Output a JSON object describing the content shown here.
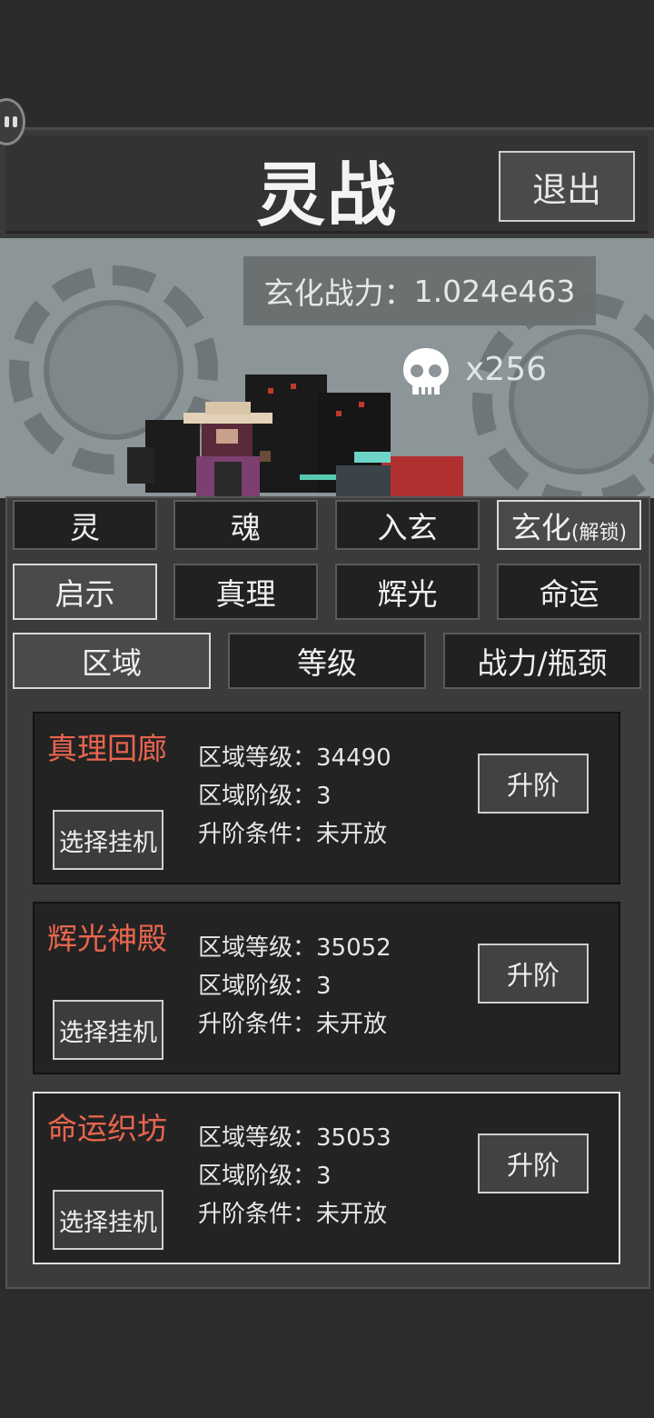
{
  "header": {
    "title": "灵战",
    "exit_label": "退出"
  },
  "battle": {
    "power_label": "玄化战力：",
    "power_value": "1.024e463",
    "kills": "x256",
    "kill_icon": "skull-icon"
  },
  "tabs_row1": [
    {
      "label": "灵"
    },
    {
      "label": "魂"
    },
    {
      "label": "入玄"
    },
    {
      "label": "玄化",
      "sub": "(解锁)"
    }
  ],
  "tabs_row2": [
    {
      "label": "启示",
      "active": true
    },
    {
      "label": "真理"
    },
    {
      "label": "辉光"
    },
    {
      "label": "命运"
    }
  ],
  "tabs_row3": [
    {
      "label": "区域",
      "active": true
    },
    {
      "label": "等级"
    },
    {
      "label": "战力/瓶颈"
    }
  ],
  "zones": [
    {
      "name": "真理回廊",
      "level_label": "区域等级：",
      "level": "34490",
      "stage_label": "区域阶级：",
      "stage": "3",
      "cond_label": "升阶条件：",
      "cond": "未开放",
      "select_label": "选择挂机",
      "upgrade_label": "升阶",
      "selected": false
    },
    {
      "name": "辉光神殿",
      "level_label": "区域等级：",
      "level": "35052",
      "stage_label": "区域阶级：",
      "stage": "3",
      "cond_label": "升阶条件：",
      "cond": "未开放",
      "select_label": "选择挂机",
      "upgrade_label": "升阶",
      "selected": false
    },
    {
      "name": "命运织坊",
      "level_label": "区域等级：",
      "level": "35053",
      "stage_label": "区域阶级：",
      "stage": "3",
      "cond_label": "升阶条件：",
      "cond": "未开放",
      "select_label": "选择挂机",
      "upgrade_label": "升阶",
      "selected": true
    }
  ],
  "colors": {
    "zone_name": "#e8654f",
    "background": "#2b2b2b",
    "panel": "#3b3b3b"
  }
}
